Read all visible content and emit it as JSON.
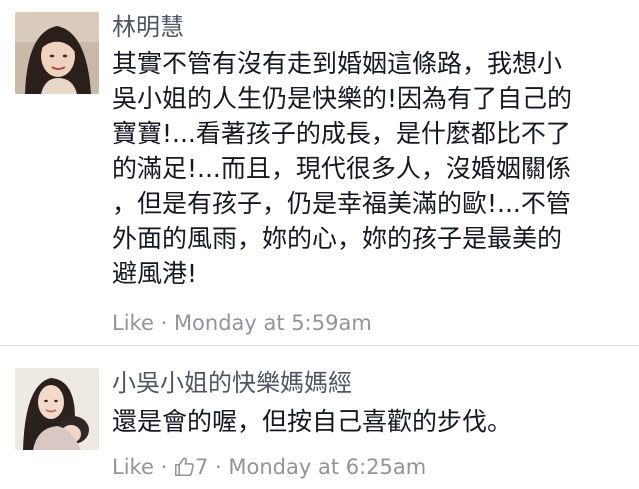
{
  "comments": [
    {
      "author": "林明慧",
      "text": "其實不管有沒有走到婚姻這條路，我想小\n吳小姐的人生仍是快樂的!因為有了自己的\n寶寶!...看著孩子的成長，是什麼都比不了\n的滿足!...而且，現代很多人，沒婚姻關係\n，但是有孩子，仍是幸福美滿的歐!...不管\n外面的風雨，妳的心，妳的孩子是最美的\n避風港!",
      "like_label": "Like",
      "separator": "·",
      "timestamp": "Monday at 5:59am"
    },
    {
      "author": "小吳小姐的快樂媽媽經",
      "text": "還是會的喔，但按自己喜歡的步伐。",
      "like_label": "Like",
      "separator": "·",
      "like_count": "7",
      "separator2": "·",
      "timestamp": "Monday at 6:25am"
    }
  ],
  "icons": {
    "like_count_icon": "thumbs-up-icon"
  },
  "colors": {
    "author": "#4e5665",
    "meta": "#90949c",
    "divider": "#dddfe2"
  }
}
